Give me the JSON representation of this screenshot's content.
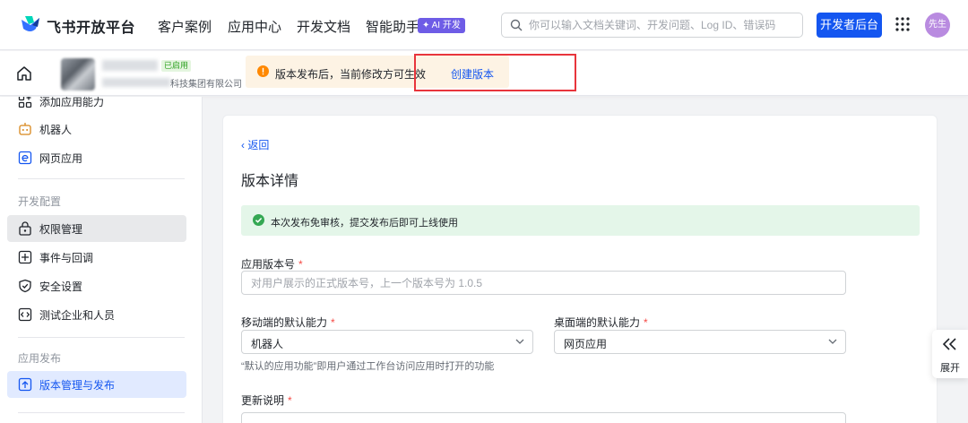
{
  "topbar": {
    "brand": "飞书开放平台",
    "nav": [
      "客户案例",
      "应用中心",
      "开发文档",
      "智能助手"
    ],
    "ai_badge": "✦ AI 开发",
    "search_placeholder": "你可以输入文档关键词、开发问题、Log ID、错误码",
    "dev_button": "开发者后台",
    "avatar_text": "先生"
  },
  "subbar": {
    "app_status": "已启用",
    "company_suffix": "科技集团有限公司",
    "notice_text": "版本发布后，当前修改方可生效",
    "create_link": "创建版本"
  },
  "sidebar": {
    "items_top": [
      "添加应用能力",
      "机器人",
      "网页应用"
    ],
    "group_dev": "开发配置",
    "items_dev": [
      "权限管理",
      "事件与回调",
      "安全设置",
      "测试企业和人员"
    ],
    "group_release": "应用发布",
    "items_release": [
      "版本管理与发布"
    ]
  },
  "main": {
    "back": "返回",
    "title": "版本详情",
    "success_text": "本次发布免审核，提交发布后即可上线使用",
    "version_label": "应用版本号",
    "version_placeholder": "对用户展示的正式版本号，上一个版本号为 1.0.5",
    "mobile_label": "移动端的默认能力",
    "mobile_value": "机器人",
    "desktop_label": "桌面端的默认能力",
    "desktop_value": "网页应用",
    "default_hint": "“默认的应用功能”即用户通过工作台访问应用时打开的功能",
    "update_label": "更新说明",
    "required_mark": "*"
  },
  "expand": {
    "label": "展开"
  },
  "colors": {
    "primary": "#1456f0",
    "danger": "#e8353c",
    "success": "#34a853",
    "warning": "#ff8800"
  }
}
